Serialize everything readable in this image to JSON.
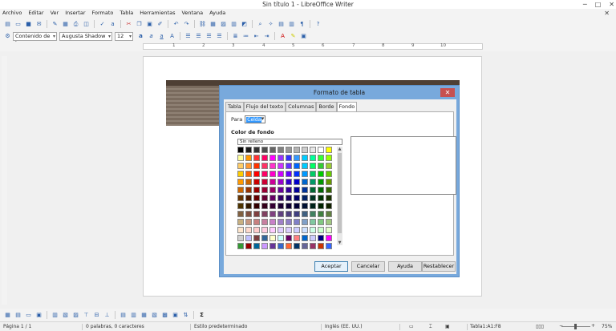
{
  "window": {
    "title": "Sin título 1 - LibreOffice Writer",
    "minimize": "─",
    "maximize": "□",
    "close": "✕"
  },
  "menu": [
    "Archivo",
    "Editar",
    "Ver",
    "Insertar",
    "Formato",
    "Tabla",
    "Herramientas",
    "Ventana",
    "Ayuda"
  ],
  "formatting": {
    "paragraph_style": "Contenido de la",
    "font_name": "Augusta Shadow",
    "font_size": "12"
  },
  "ruler": {
    "numbers": [
      "1",
      "2",
      "3",
      "4",
      "5",
      "6",
      "7",
      "8",
      "9",
      "10"
    ]
  },
  "dialog": {
    "title": "Formato de tabla",
    "tabs": [
      "Tabla",
      "Flujo del texto",
      "Columnas",
      "Borde",
      "Fondo"
    ],
    "active_tab": "Fondo",
    "para_label": "Para",
    "para_value": "Celda",
    "section_title": "Color de fondo",
    "no_fill": "Sin relleno",
    "buttons": {
      "ok": "Aceptar",
      "cancel": "Cancelar",
      "help": "Ayuda",
      "reset": "Restablecer"
    }
  },
  "palette_colors": [
    [
      "#000000",
      "#1a1a1a",
      "#333333",
      "#4d4d4d",
      "#666666",
      "#808080",
      "#999999",
      "#b3b3b3",
      "#cccccc",
      "#e6e6e6",
      "#ffffff",
      "#ffff00"
    ],
    [
      "#ffff99",
      "#ff9900",
      "#ff3333",
      "#ff0066",
      "#ff00ff",
      "#9933ff",
      "#3333ff",
      "#3399ff",
      "#00ccff",
      "#00ff99",
      "#33ff33",
      "#99ff00"
    ],
    [
      "#ffcc66",
      "#ff9933",
      "#ff3300",
      "#ff3366",
      "#ff33cc",
      "#cc33ff",
      "#6633ff",
      "#0066ff",
      "#00ccff",
      "#00ff66",
      "#33cc33",
      "#99cc33"
    ],
    [
      "#ffcc00",
      "#ff6600",
      "#ff0000",
      "#ff0066",
      "#ff00cc",
      "#cc00ff",
      "#6600ff",
      "#0033ff",
      "#0099ff",
      "#00cc66",
      "#00cc00",
      "#66cc00"
    ],
    [
      "#ff9900",
      "#cc6600",
      "#cc0000",
      "#cc0033",
      "#cc0099",
      "#9900cc",
      "#3300cc",
      "#0000cc",
      "#0066cc",
      "#009966",
      "#009900",
      "#669900"
    ],
    [
      "#cc6600",
      "#993300",
      "#990000",
      "#990033",
      "#990066",
      "#660099",
      "#330099",
      "#000099",
      "#003399",
      "#006633",
      "#006600",
      "#336600"
    ],
    [
      "#663300",
      "#4d1a00",
      "#660000",
      "#660033",
      "#660066",
      "#330066",
      "#1a0066",
      "#000066",
      "#002266",
      "#003322",
      "#003300",
      "#1a3300"
    ],
    [
      "#4d3300",
      "#331a00",
      "#330000",
      "#33001a",
      "#330033",
      "#1a0033",
      "#0d0033",
      "#000033",
      "#001133",
      "#00221a",
      "#002200",
      "#112200"
    ],
    [
      "#806040",
      "#805040",
      "#804040",
      "#804060",
      "#804080",
      "#604080",
      "#504080",
      "#404080",
      "#406080",
      "#408060",
      "#408040",
      "#608040"
    ],
    [
      "#c8b080",
      "#c89880",
      "#c88080",
      "#c880a0",
      "#c880c8",
      "#a080c8",
      "#9080c8",
      "#8080c8",
      "#80a0c8",
      "#80c8a0",
      "#80c880",
      "#a0c880"
    ],
    [
      "#ffe6cc",
      "#ffd9cc",
      "#ffcccc",
      "#ffcce0",
      "#ffccff",
      "#e0ccff",
      "#d9ccff",
      "#ccccff",
      "#cce0ff",
      "#ccffe6",
      "#ccffcc",
      "#e6ffcc"
    ],
    [
      "#d0d0d0",
      "#c0c0ff",
      "#7b3f3f",
      "#336699",
      "#ffffcc",
      "#ccffff",
      "#660066",
      "#ff8080",
      "#0066cc",
      "#ccccff",
      "#000080",
      "#ff00ff"
    ],
    [
      "#339933",
      "#990000",
      "#006699",
      "#cc99ff",
      "#663399",
      "#3366cc",
      "#ff6633",
      "#003366",
      "#666699",
      "#993366",
      "#cc3300",
      "#3366ff"
    ]
  ],
  "status": {
    "page": "Página 1 / 1",
    "words": "0 palabras, 0 caracteres",
    "style": "Estilo predeterminado",
    "language": "Inglés (EE. UU.)",
    "cell": "Tabla1:A1:F8",
    "zoom": "75%"
  }
}
